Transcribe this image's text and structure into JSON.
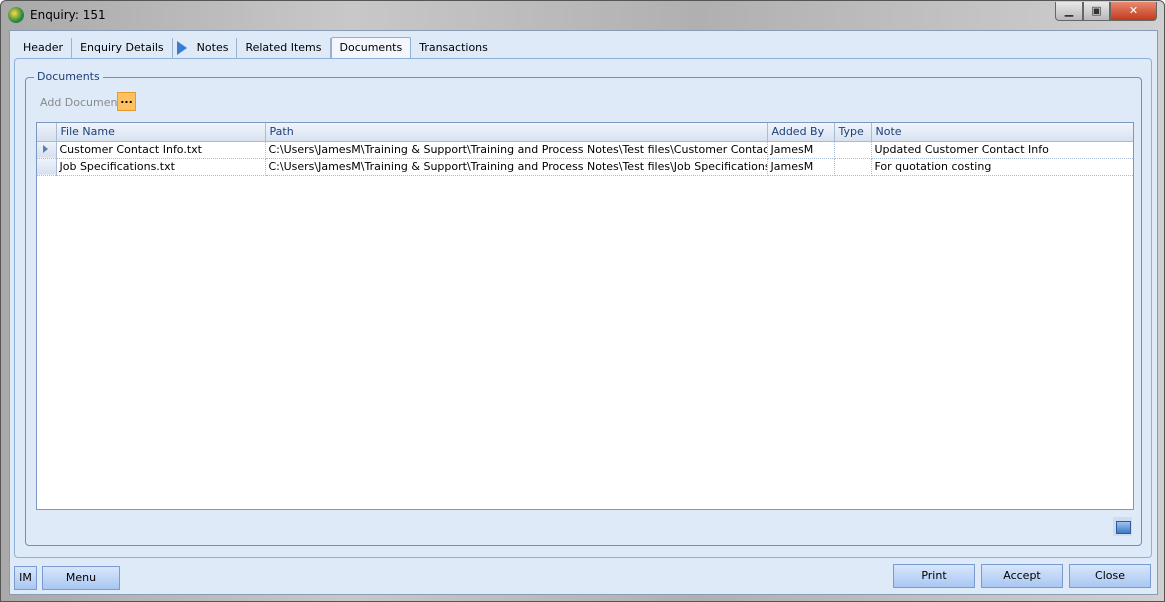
{
  "window": {
    "title": "Enquiry: 151"
  },
  "tabs": [
    {
      "label": "Header"
    },
    {
      "label": "Enquiry Details"
    },
    {
      "label": "Notes"
    },
    {
      "label": "Related Items"
    },
    {
      "label": "Documents"
    },
    {
      "label": "Transactions"
    }
  ],
  "documents": {
    "group_label": "Documents",
    "add_label": "Add Document",
    "add_button": "...",
    "columns": [
      "File Name",
      "Path",
      "Added By",
      "Type",
      "Note"
    ],
    "rows": [
      {
        "file": "Customer Contact Info.txt",
        "path": "C:\\Users\\JamesM\\Training & Support\\Training and Process Notes\\Test files\\Customer Contact Info.txt",
        "added_by": "JamesM",
        "type": "",
        "note": "Updated Customer Contact Info"
      },
      {
        "file": "Job Specifications.txt",
        "path": "C:\\Users\\JamesM\\Training & Support\\Training and Process Notes\\Test files\\Job Specifications.txt",
        "added_by": "JamesM",
        "type": "",
        "note": "For quotation costing"
      }
    ]
  },
  "footer": {
    "im": "IM",
    "menu": "Menu",
    "print": "Print",
    "accept": "Accept",
    "close": "Close"
  }
}
